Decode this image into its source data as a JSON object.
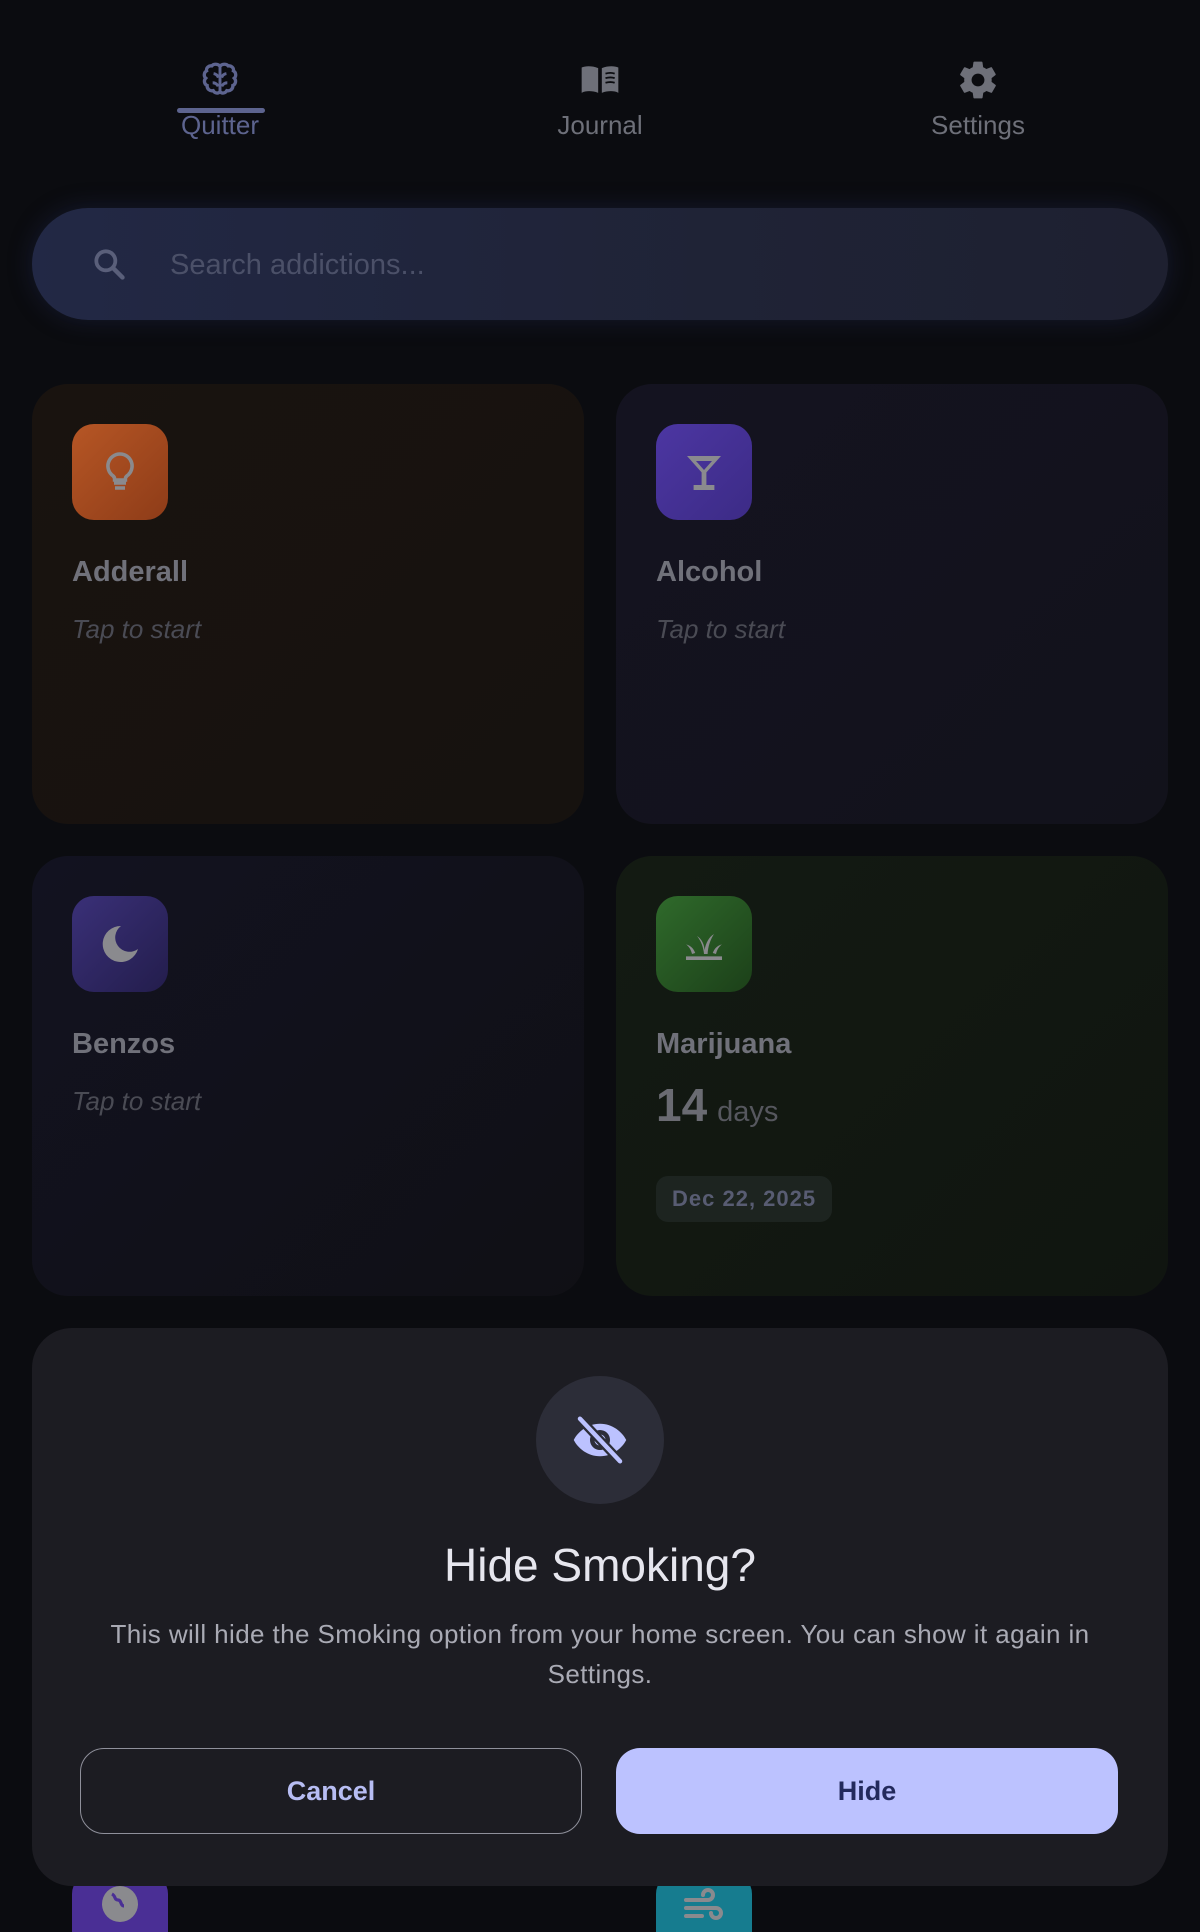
{
  "nav": {
    "tabs": [
      {
        "label": "Quitter",
        "icon": "brain-icon",
        "active": true
      },
      {
        "label": "Journal",
        "icon": "book-icon",
        "active": false
      },
      {
        "label": "Settings",
        "icon": "gear-icon",
        "active": false
      }
    ],
    "accent_color": "#5d648f"
  },
  "search": {
    "placeholder": "Search addictions...",
    "value": "",
    "icon": "search-icon"
  },
  "cards": [
    {
      "name": "Adderall",
      "status": "Tap to start",
      "icon": "lightbulb-icon",
      "color": "#b65625"
    },
    {
      "name": "Alcohol",
      "status": "Tap to start",
      "icon": "cocktail-icon",
      "color": "#4c36a2"
    },
    {
      "name": "Benzos",
      "status": "Tap to start",
      "icon": "moon-icon",
      "color": "#3a3078"
    },
    {
      "name": "Marijuana",
      "days_count": "14",
      "days_unit": "days",
      "start_date": "Dec 22, 2025",
      "icon": "plant-icon",
      "color": "#2f6a2b"
    }
  ],
  "peek_tiles": [
    {
      "icon": "globe-icon",
      "color": "#4a2f95"
    },
    {
      "icon": "smoke-icon",
      "color": "#167c8f"
    }
  ],
  "dialog": {
    "icon": "eye-off-icon",
    "title": "Hide Smoking?",
    "body": "This will hide the Smoking option from your home screen. You can show it again in Settings.",
    "cancel_label": "Cancel",
    "confirm_label": "Hide",
    "confirm_color": "#bcc2ff"
  }
}
